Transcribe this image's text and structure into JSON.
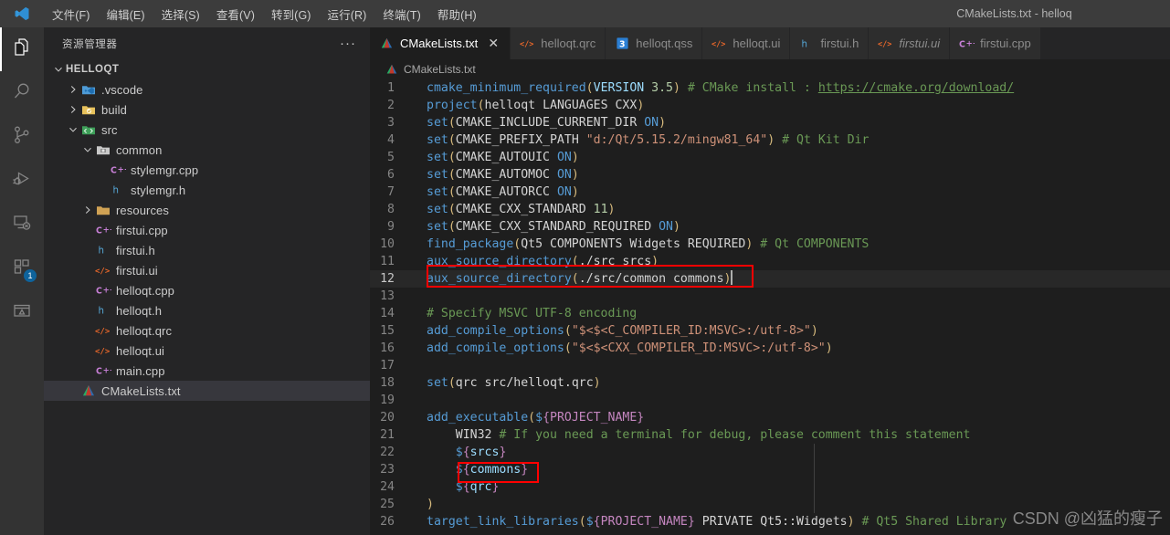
{
  "titlebar": {
    "logo_icon": "vscode-logo-icon",
    "title": "CMakeLists.txt - helloq",
    "menus": [
      {
        "label": "文件(F)",
        "name": "menu-file"
      },
      {
        "label": "编辑(E)",
        "name": "menu-edit"
      },
      {
        "label": "选择(S)",
        "name": "menu-selection"
      },
      {
        "label": "查看(V)",
        "name": "menu-view"
      },
      {
        "label": "转到(G)",
        "name": "menu-go"
      },
      {
        "label": "运行(R)",
        "name": "menu-run"
      },
      {
        "label": "终端(T)",
        "name": "menu-terminal"
      },
      {
        "label": "帮助(H)",
        "name": "menu-help"
      }
    ]
  },
  "activitybar": {
    "items": [
      {
        "name": "activity-explorer",
        "icon": "files-icon",
        "active": true,
        "badge": ""
      },
      {
        "name": "activity-search",
        "icon": "search-icon",
        "active": false,
        "badge": ""
      },
      {
        "name": "activity-source-control",
        "icon": "source-control-icon",
        "active": false,
        "badge": ""
      },
      {
        "name": "activity-run-debug",
        "icon": "run-and-debug-icon",
        "active": false,
        "badge": ""
      },
      {
        "name": "activity-remote-explorer",
        "icon": "remote-explorer-icon",
        "active": false,
        "badge": ""
      },
      {
        "name": "activity-extensions",
        "icon": "extensions-icon",
        "active": false,
        "badge": "1"
      },
      {
        "name": "activity-testing",
        "icon": "testing-beaker-icon",
        "active": false,
        "badge": ""
      }
    ]
  },
  "sidebar": {
    "header_title": "资源管理器",
    "more_actions": "···",
    "tree": [
      {
        "label": "HELLOQT",
        "depth": 0,
        "type": "root-folder",
        "expanded": true,
        "icon": "",
        "selected": false
      },
      {
        "label": ".vscode",
        "depth": 1,
        "type": "folder",
        "expanded": false,
        "icon": "folder-vscode-icon",
        "selected": false
      },
      {
        "label": "build",
        "depth": 1,
        "type": "folder",
        "expanded": false,
        "icon": "folder-build-icon",
        "selected": false
      },
      {
        "label": "src",
        "depth": 1,
        "type": "folder",
        "expanded": true,
        "icon": "folder-src-icon",
        "selected": false
      },
      {
        "label": "common",
        "depth": 2,
        "type": "folder",
        "expanded": true,
        "icon": "folder-common-icon",
        "selected": false
      },
      {
        "label": "stylemgr.cpp",
        "depth": 3,
        "type": "file",
        "icon": "cpp-icon",
        "selected": false
      },
      {
        "label": "stylemgr.h",
        "depth": 3,
        "type": "file",
        "icon": "h-icon",
        "selected": false
      },
      {
        "label": "resources",
        "depth": 2,
        "type": "folder",
        "expanded": false,
        "icon": "folder-resources-icon",
        "selected": false
      },
      {
        "label": "firstui.cpp",
        "depth": 2,
        "type": "file",
        "icon": "cpp-icon",
        "selected": false
      },
      {
        "label": "firstui.h",
        "depth": 2,
        "type": "file",
        "icon": "h-icon",
        "selected": false
      },
      {
        "label": "firstui.ui",
        "depth": 2,
        "type": "file",
        "icon": "xml-icon",
        "selected": false
      },
      {
        "label": "helloqt.cpp",
        "depth": 2,
        "type": "file",
        "icon": "cpp-icon",
        "selected": false
      },
      {
        "label": "helloqt.h",
        "depth": 2,
        "type": "file",
        "icon": "h-icon",
        "selected": false
      },
      {
        "label": "helloqt.qrc",
        "depth": 2,
        "type": "file",
        "icon": "xml-icon",
        "selected": false
      },
      {
        "label": "helloqt.ui",
        "depth": 2,
        "type": "file",
        "icon": "xml-icon",
        "selected": false
      },
      {
        "label": "main.cpp",
        "depth": 2,
        "type": "file",
        "icon": "cpp-icon",
        "selected": false
      },
      {
        "label": "CMakeLists.txt",
        "depth": 1,
        "type": "file",
        "icon": "cmake-icon",
        "selected": true
      }
    ]
  },
  "tabs": [
    {
      "label": "CMakeLists.txt",
      "icon": "cmake-icon",
      "active": true,
      "preview": false,
      "close": "✕"
    },
    {
      "label": "helloqt.qrc",
      "icon": "xml-icon",
      "active": false,
      "preview": false,
      "close": ""
    },
    {
      "label": "helloqt.qss",
      "icon": "css-icon",
      "active": false,
      "preview": false,
      "close": ""
    },
    {
      "label": "helloqt.ui",
      "icon": "xml-icon",
      "active": false,
      "preview": false,
      "close": ""
    },
    {
      "label": "firstui.h",
      "icon": "h-icon",
      "active": false,
      "preview": false,
      "close": ""
    },
    {
      "label": "firstui.ui",
      "icon": "xml-icon",
      "active": false,
      "preview": true,
      "close": ""
    },
    {
      "label": "firstui.cpp",
      "icon": "cpp-icon",
      "active": false,
      "preview": false,
      "close": ""
    }
  ],
  "breadcrumb": {
    "icon": "cmake-icon",
    "label": "CMakeLists.txt"
  },
  "editor": {
    "current_line": 12,
    "lines": [
      {
        "n": 1,
        "text": "cmake_minimum_required(VERSION 3.5) # CMake install : https://cmake.org/download/"
      },
      {
        "n": 2,
        "text": "project(helloqt LANGUAGES CXX)"
      },
      {
        "n": 3,
        "text": "set(CMAKE_INCLUDE_CURRENT_DIR ON)"
      },
      {
        "n": 4,
        "text": "set(CMAKE_PREFIX_PATH \"d:/Qt/5.15.2/mingw81_64\") # Qt Kit Dir"
      },
      {
        "n": 5,
        "text": "set(CMAKE_AUTOUIC ON)"
      },
      {
        "n": 6,
        "text": "set(CMAKE_AUTOMOC ON)"
      },
      {
        "n": 7,
        "text": "set(CMAKE_AUTORCC ON)"
      },
      {
        "n": 8,
        "text": "set(CMAKE_CXX_STANDARD 11)"
      },
      {
        "n": 9,
        "text": "set(CMAKE_CXX_STANDARD_REQUIRED ON)"
      },
      {
        "n": 10,
        "text": "find_package(Qt5 COMPONENTS Widgets REQUIRED) # Qt COMPONENTS"
      },
      {
        "n": 11,
        "text": "aux_source_directory(./src srcs)"
      },
      {
        "n": 12,
        "text": "aux_source_directory(./src/common commons)"
      },
      {
        "n": 13,
        "text": ""
      },
      {
        "n": 14,
        "text": "# Specify MSVC UTF-8 encoding"
      },
      {
        "n": 15,
        "text": "add_compile_options(\"$<$<C_COMPILER_ID:MSVC>:/utf-8>\")"
      },
      {
        "n": 16,
        "text": "add_compile_options(\"$<$<CXX_COMPILER_ID:MSVC>:/utf-8>\")"
      },
      {
        "n": 17,
        "text": ""
      },
      {
        "n": 18,
        "text": "set(qrc src/helloqt.qrc)"
      },
      {
        "n": 19,
        "text": ""
      },
      {
        "n": 20,
        "text": "add_executable(${PROJECT_NAME}"
      },
      {
        "n": 21,
        "text": "    WIN32 # If you need a terminal for debug, please comment this statement"
      },
      {
        "n": 22,
        "text": "    ${srcs}"
      },
      {
        "n": 23,
        "text": "    ${commons}"
      },
      {
        "n": 24,
        "text": "    ${qrc}"
      },
      {
        "n": 25,
        "text": ")"
      },
      {
        "n": 26,
        "text": "target_link_libraries(${PROJECT_NAME} PRIVATE Qt5::Widgets) # Qt5 Shared Library"
      }
    ]
  },
  "annotations": [
    {
      "name": "highlight-box-line12",
      "color": "#ff0000"
    },
    {
      "name": "highlight-box-line23",
      "color": "#ff0000"
    }
  ],
  "watermark": {
    "text": "CSDN @凶猛的瘦子"
  }
}
